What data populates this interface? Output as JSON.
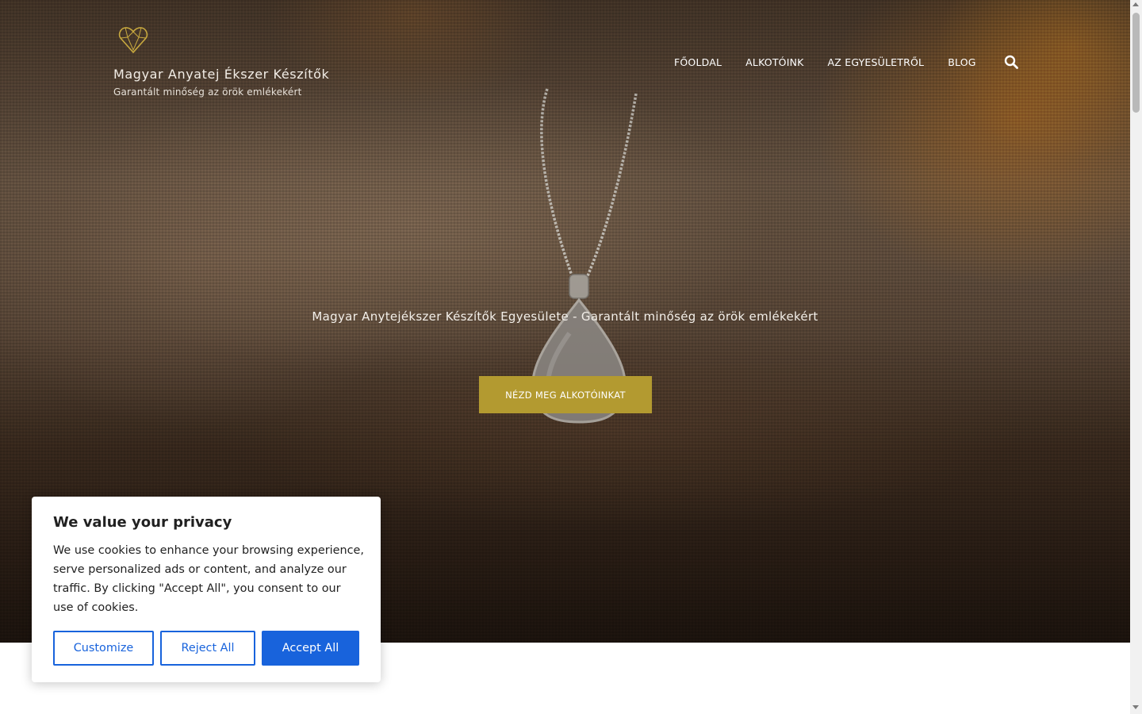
{
  "header": {
    "site_title": "Magyar Anyatej Ékszer Készítők",
    "tagline": "Garantált minőség az örök emlékekért",
    "logo_icon": "heart-diamond-icon"
  },
  "nav": {
    "items": [
      {
        "label": "FŐOLDAL"
      },
      {
        "label": "ALKOTÓINK"
      },
      {
        "label": "AZ EGYESÜLETRŐL"
      },
      {
        "label": "BLOG"
      }
    ],
    "search_icon": "search-icon"
  },
  "hero": {
    "heading": "Magyar Anytejékszer Készítők Egyesülete - Garantált minőség az örök emlékekért",
    "cta_label": "NÉZD MEG ALKOTÓINKAT"
  },
  "cookie_banner": {
    "title": "We value your privacy",
    "text": "We use cookies to enhance your browsing experience, serve personalized ads or content, and analyze our traffic. By clicking \"Accept All\", you consent to our use of cookies.",
    "customize_label": "Customize",
    "reject_label": "Reject All",
    "accept_label": "Accept All"
  },
  "colors": {
    "accent_gold": "#b39a30",
    "cookie_blue": "#1863dc",
    "nav_text": "#ffffff"
  }
}
